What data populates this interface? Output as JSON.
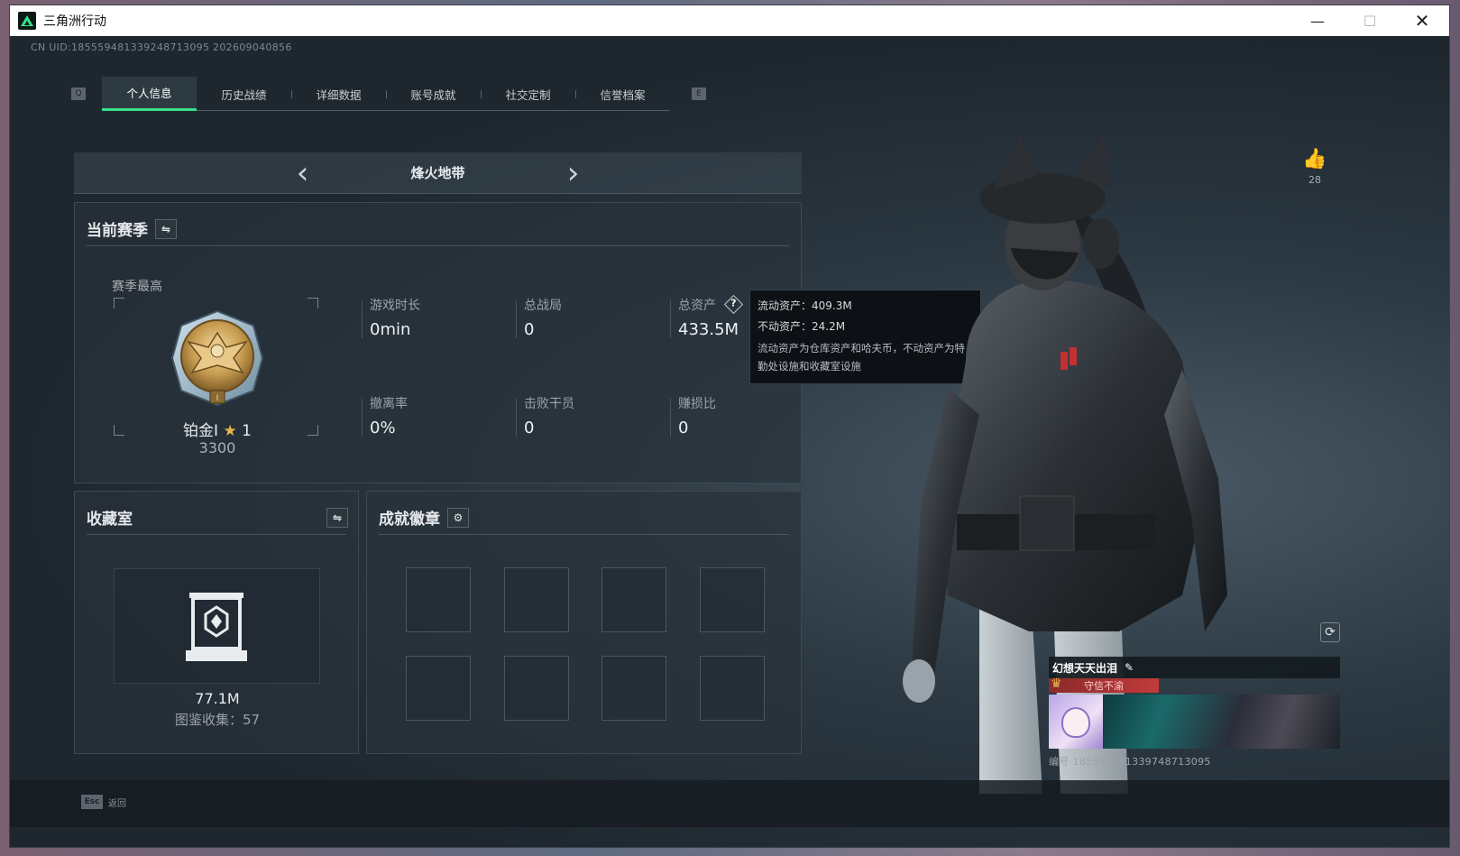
{
  "window": {
    "title": "三角洲行动",
    "minimize": "—",
    "maximize": "☐",
    "close": "✕"
  },
  "header": {
    "uid": "CN UID:18555948133924871309​5 202609040856"
  },
  "tabs": {
    "left_key": "Q",
    "right_key": "E",
    "items": [
      {
        "label": "个人信息",
        "active": true
      },
      {
        "label": "历史战绩",
        "active": false
      },
      {
        "label": "详细数据",
        "active": false
      },
      {
        "label": "账号成就",
        "active": false
      },
      {
        "label": "社交定制",
        "active": false
      },
      {
        "label": "信誉档案",
        "active": false
      }
    ]
  },
  "mode": {
    "name": "烽火地带",
    "prev": "‹",
    "next": "›"
  },
  "season": {
    "title": "当前赛季",
    "season_best_label": "赛季最高",
    "rank_name": "铂金I",
    "rank_star": "★",
    "rank_star_count": "1",
    "rank_score": "3300",
    "stats": {
      "play_time": {
        "label": "游戏时长",
        "value": "0min"
      },
      "total_matches": {
        "label": "总战局",
        "value": "0"
      },
      "total_assets": {
        "label": "总资产",
        "value": "433.5M",
        "help": "?"
      },
      "extract_rate": {
        "label": "撤离率",
        "value": "0%"
      },
      "kills": {
        "label": "击败干员",
        "value": "0"
      },
      "profit_ratio": {
        "label": "赚损比",
        "value": "0"
      }
    }
  },
  "tooltip": {
    "liquid": "流动资产：409.3M",
    "fixed": "不动资产：24.2M",
    "desc": "流动资产为仓库资产和哈夫币，不动资产为特勤处设施和收藏室设施"
  },
  "collection": {
    "title": "收藏室",
    "value": "77.1M",
    "count_text": "图鉴收集：57"
  },
  "achievements": {
    "title": "成就徽章"
  },
  "likes": {
    "count": "28"
  },
  "card": {
    "player_name": "幻想天天出泪",
    "tag": "守信不渝",
    "id_text": "编号 18555948133974871309​5"
  },
  "footer": {
    "esc_key": "Esc",
    "esc_label": "返回"
  },
  "colors": {
    "accent": "#37e08a",
    "tag_red": "#c23a3a",
    "panel_bg": "#28323a"
  },
  "icons": {
    "switch": "swap-icon",
    "settings": "gear-icon",
    "like": "thumbs-up-icon",
    "refresh": "refresh-icon",
    "edit": "pencil-icon"
  }
}
